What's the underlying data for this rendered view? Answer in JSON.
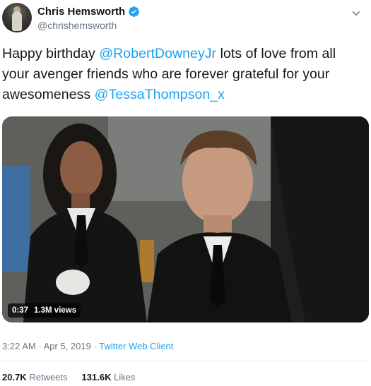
{
  "tweet": {
    "display_name": "Chris Hemsworth",
    "handle": "@chrishemsworth",
    "verified_icon": "verified-badge-icon",
    "avatar_icon": "avatar",
    "text_part1": "Happy birthday ",
    "mention1": "@RobertDowneyJr",
    "text_part2": " lots of love from all your avenger friends who are forever grateful for your awesomeness ",
    "mention2": "@TessaThompson_x",
    "media": {
      "type": "video",
      "duration": "0:37",
      "views": "1.3M views"
    },
    "time": "3:22 AM",
    "date": "Apr 5, 2019",
    "separator": "·",
    "client": "Twitter Web Client",
    "retweets_count": "20.7K",
    "retweets_label": "Retweets",
    "likes_count": "131.6K",
    "likes_label": "Likes"
  },
  "colors": {
    "link": "#1da1f2",
    "muted": "#657786",
    "text": "#14171a",
    "divider": "#e6ecf0"
  }
}
